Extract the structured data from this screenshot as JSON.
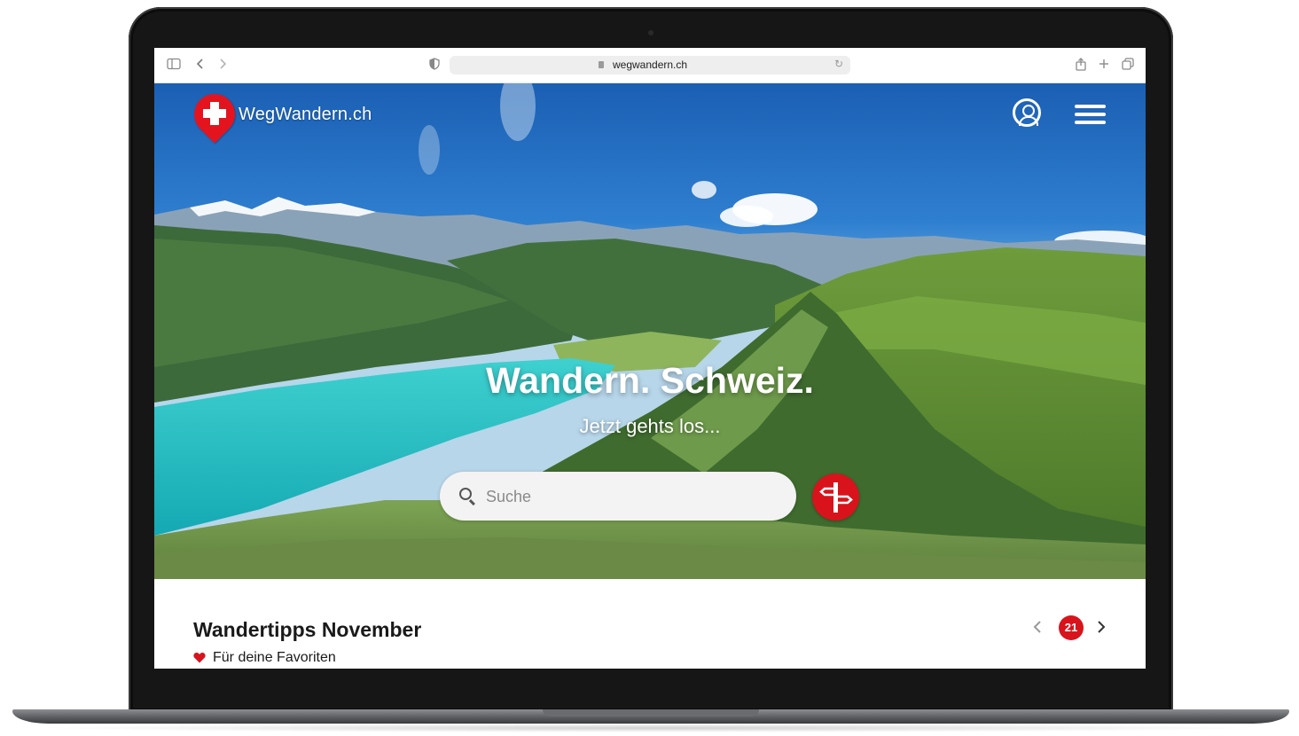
{
  "browser": {
    "url": "wegwandern.ch"
  },
  "site": {
    "logo_text": "WegWandern.ch"
  },
  "hero": {
    "title": "Wandern. Schweiz.",
    "subtitle": "Jetzt gehts los...",
    "search_placeholder": "Suche"
  },
  "section": {
    "title": "Wandertipps November",
    "subtitle": "Für deine Favoriten",
    "count_badge": "21"
  },
  "icons": [
    "sidebar-icon",
    "back-icon",
    "forward-icon",
    "shield-icon",
    "lock-icon",
    "reload-icon",
    "share-icon",
    "new-tab-icon",
    "tabs-icon",
    "swiss-cross-pin-icon",
    "user-icon",
    "hamburger-menu-icon",
    "search-icon",
    "signpost-icon",
    "heart-icon",
    "chevron-left-icon",
    "chevron-right-icon"
  ],
  "colors": {
    "brand_red": "#d9131c",
    "laptop_frame": "#161616",
    "lake_turquoise": "#1fb8c0"
  }
}
